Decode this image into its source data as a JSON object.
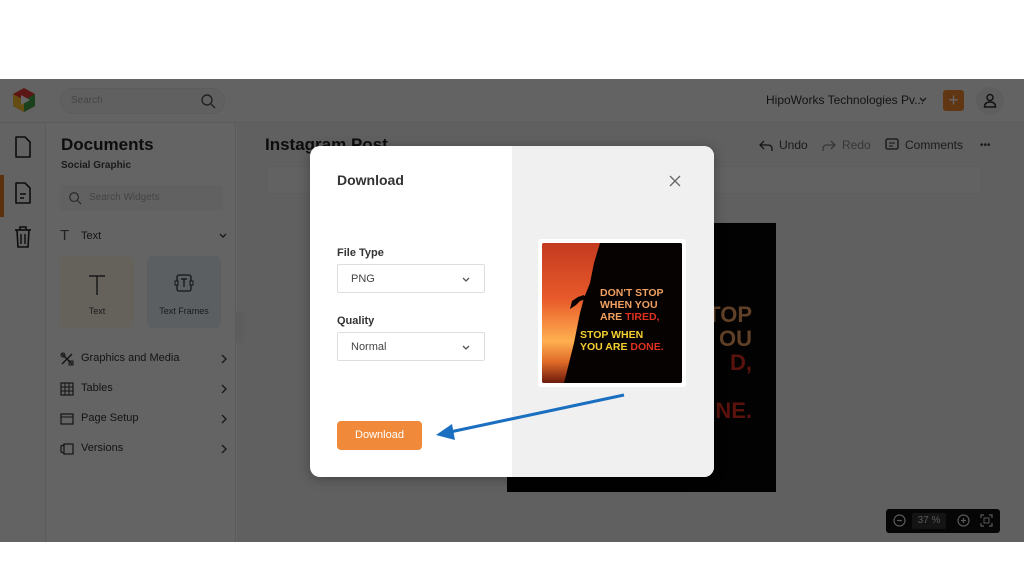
{
  "topbar": {
    "search_placeholder": "Search",
    "org_name": "HipoWorks Technologies Pv...",
    "add_label": "+"
  },
  "rail": {
    "items": [
      {
        "icon": "document-icon",
        "active": false
      },
      {
        "icon": "document-lines-icon",
        "active": true
      },
      {
        "icon": "trash-icon",
        "active": false
      }
    ]
  },
  "panel": {
    "title": "Documents",
    "subtitle": "Social Graphic",
    "widget_search_placeholder": "Search Widgets",
    "text_section": {
      "label": "Text",
      "tiles": [
        {
          "label": "Text",
          "icon": "text-icon"
        },
        {
          "label": "Text Frames",
          "icon": "text-frame-icon"
        }
      ]
    },
    "menu": [
      {
        "label": "Graphics and Media",
        "icon": "graphics-icon"
      },
      {
        "label": "Tables",
        "icon": "table-icon"
      },
      {
        "label": "Page Setup",
        "icon": "page-setup-icon"
      },
      {
        "label": "Versions",
        "icon": "versions-icon"
      }
    ]
  },
  "editor": {
    "doc_title": "Instagram Post",
    "toolbar": {
      "undo": "Undo",
      "redo": "Redo",
      "comments": "Comments",
      "more": "•••"
    },
    "poster_lines": [
      "TOP",
      "OU",
      "D,",
      "",
      "NE."
    ],
    "zoom": {
      "value": "37",
      "unit": "%"
    }
  },
  "modal": {
    "title": "Download",
    "file_type_label": "File Type",
    "file_type_value": "PNG",
    "quality_label": "Quality",
    "quality_value": "Normal",
    "download_label": "Download",
    "preview": {
      "line1": "DON'T STOP",
      "line2": "WHEN YOU",
      "line3a": "ARE ",
      "line3b": "TIRED,",
      "line4": "STOP WHEN",
      "line5a": "YOU ARE ",
      "line5b": "DONE."
    }
  },
  "colors": {
    "accent": "#f08a3a",
    "arrow": "#1a6fc0",
    "quote_orange": "#f0a060",
    "quote_yellow": "#f5d030",
    "quote_red": "#e03020"
  }
}
